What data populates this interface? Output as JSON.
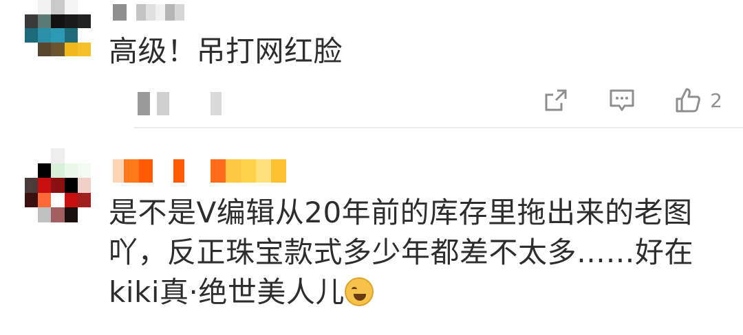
{
  "comments": [
    {
      "text": "高级！吊打网红脸",
      "like_count": "2",
      "icons": [
        "share-icon",
        "reply-icon",
        "like-icon"
      ]
    },
    {
      "text": "是不是V编辑从20年前的库存里拖出来的老图吖，反正珠宝款式多少年都差不太多……好在kiki真·绝世美人儿"
    }
  ]
}
